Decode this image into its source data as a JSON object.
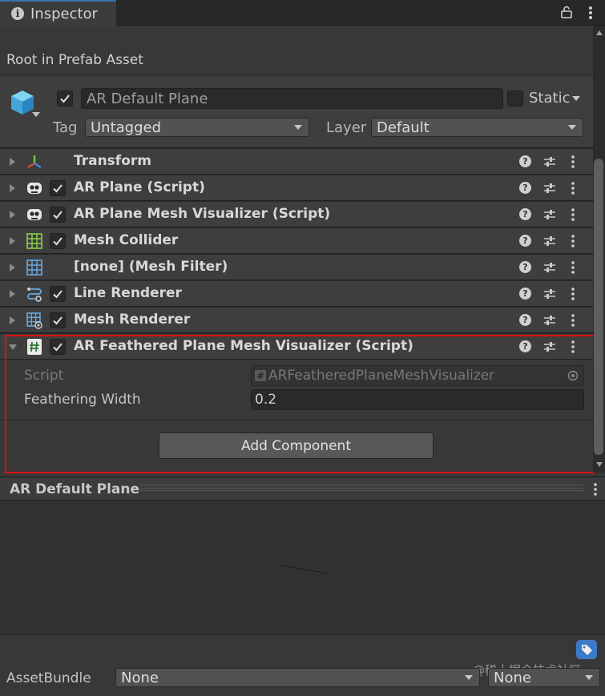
{
  "tab": {
    "title": "Inspector"
  },
  "root": {
    "label": "Root in Prefab Asset"
  },
  "object": {
    "name": "AR Default Plane",
    "static_label": "Static",
    "tag_label": "Tag",
    "tag_value": "Untagged",
    "layer_label": "Layer",
    "layer_value": "Default"
  },
  "components": [
    {
      "title": "Transform"
    },
    {
      "title": "AR Plane (Script)"
    },
    {
      "title": "AR Plane Mesh Visualizer (Script)"
    },
    {
      "title": "Mesh Collider"
    },
    {
      "title": "[none] (Mesh Filter)"
    },
    {
      "title": "Line Renderer"
    },
    {
      "title": "Mesh Renderer"
    },
    {
      "title": "AR Feathered Plane Mesh Visualizer (Script)"
    }
  ],
  "expanded": {
    "script_label": "Script",
    "script_value": "ARFeatheredPlaneMeshVisualizer",
    "width_label": "Feathering Width",
    "width_value": "0.2"
  },
  "add_component_label": "Add Component",
  "preview": {
    "title": "AR Default Plane"
  },
  "bottom": {
    "assetbundle_label": "AssetBundle",
    "assetbundle_value": "None",
    "variant_value": "None",
    "watermark": "@稀土掘金技术社区"
  },
  "colors": {
    "highlight": "#e01010",
    "tab_accent": "#3a72b0",
    "label_icon": "#3d79c9"
  }
}
